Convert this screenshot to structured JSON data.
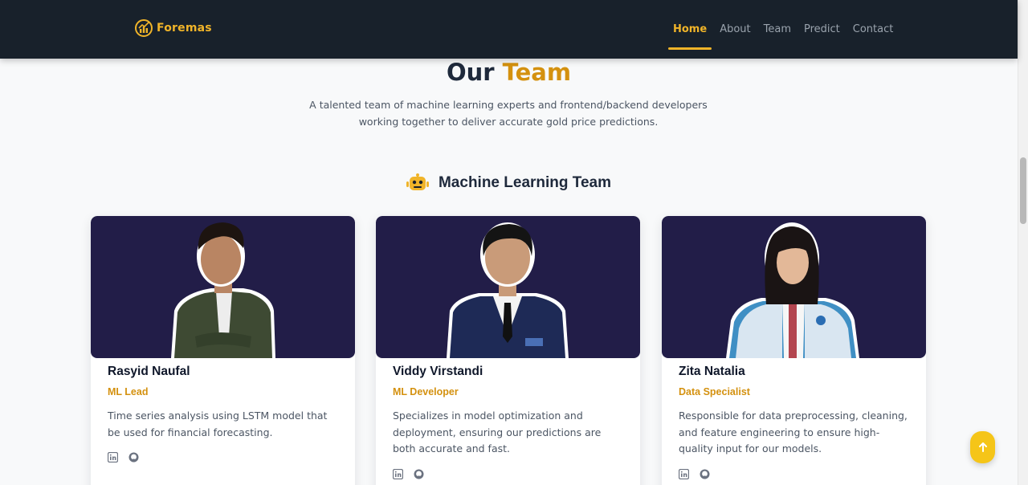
{
  "navbar": {
    "brand": "Foremas",
    "links": [
      {
        "label": "Home",
        "active": true
      },
      {
        "label": "About",
        "active": false
      },
      {
        "label": "Team",
        "active": false
      },
      {
        "label": "Predict",
        "active": false
      },
      {
        "label": "Contact",
        "active": false
      }
    ]
  },
  "header": {
    "title_main": "Our",
    "title_accent": "Team",
    "subtitle": "A talented team of machine learning experts and frontend/backend developers working together to deliver accurate gold price predictions."
  },
  "section": {
    "icon": "robot-icon",
    "title": "Machine Learning Team"
  },
  "members": [
    {
      "name": "Rasyid Naufal",
      "role": "ML Lead",
      "description": "Time series analysis using LSTM model that be used for financial forecasting.",
      "socials": [
        "linkedin-icon",
        "github-icon"
      ]
    },
    {
      "name": "Viddy Virstandi",
      "role": "ML Developer",
      "description": "Specializes in model optimization and deployment, ensuring our predictions are both accurate and fast.",
      "socials": [
        "linkedin-icon",
        "github-icon"
      ]
    },
    {
      "name": "Zita Natalia",
      "role": "Data Specialist",
      "description": "Responsible for data preprocessing, cleaning, and feature engineering to ensure high-quality input for our models.",
      "socials": [
        "linkedin-icon",
        "github-icon"
      ]
    }
  ],
  "back_to_top": {
    "icon": "arrow-up-icon"
  },
  "colors": {
    "navbar_bg": "#18212b",
    "accent": "#d4910f",
    "brand_gold": "#f0b429",
    "photo_bg": "#221d48",
    "button": "#f5c518"
  }
}
